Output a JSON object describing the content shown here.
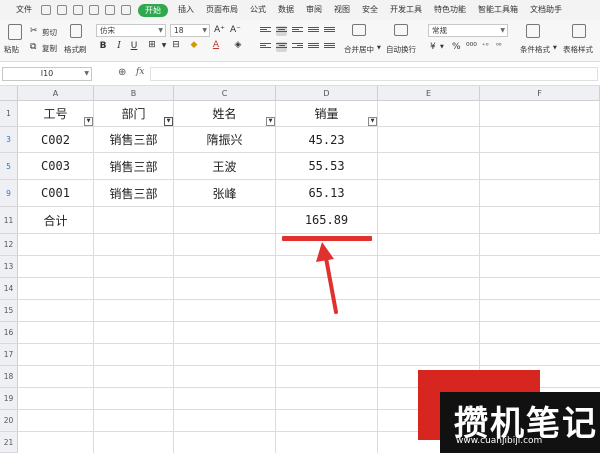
{
  "menubar": {
    "items": [
      "文件",
      "开始",
      "插入",
      "页面布局",
      "公式",
      "数据",
      "审阅",
      "视图",
      "安全",
      "开发工具",
      "特色功能",
      "智能工具箱",
      "文档助手"
    ],
    "active": "开始"
  },
  "ribbon": {
    "paste": "粘贴",
    "cut": "剪切",
    "copy": "复制",
    "format_painter": "格式刷",
    "font_name": "仿宋",
    "font_size": "18",
    "merge_center": "合并居中",
    "wrap_text": "自动换行",
    "number_format": "常规",
    "conditional_format": "条件格式",
    "table_style": "表格样式"
  },
  "formula_bar": {
    "cell_ref": "I10",
    "fx": "fx",
    "value": ""
  },
  "columns": [
    "A",
    "B",
    "C",
    "D",
    "E",
    "F"
  ],
  "rows": [
    "1",
    "3",
    "5",
    "9",
    "11",
    "12",
    "13",
    "14",
    "15",
    "16",
    "17",
    "18",
    "19",
    "20",
    "21"
  ],
  "table": {
    "headers": [
      "工号",
      "部门",
      "姓名",
      "销量"
    ],
    "data": [
      [
        "C002",
        "销售三部",
        "隋振兴",
        "45.23"
      ],
      [
        "C003",
        "销售三部",
        "王波",
        "55.53"
      ],
      [
        "C001",
        "销售三部",
        "张峰",
        "65.13"
      ]
    ],
    "total_label": "合计",
    "total_value": "165.89"
  },
  "colors": {
    "accent_green": "#2fa84f",
    "annotation_red": "#e0312f",
    "filtered_row_blue": "#2f6fd6"
  },
  "watermark": {
    "text": "攒机笔记",
    "url": "www.cuanjibiji.com"
  }
}
